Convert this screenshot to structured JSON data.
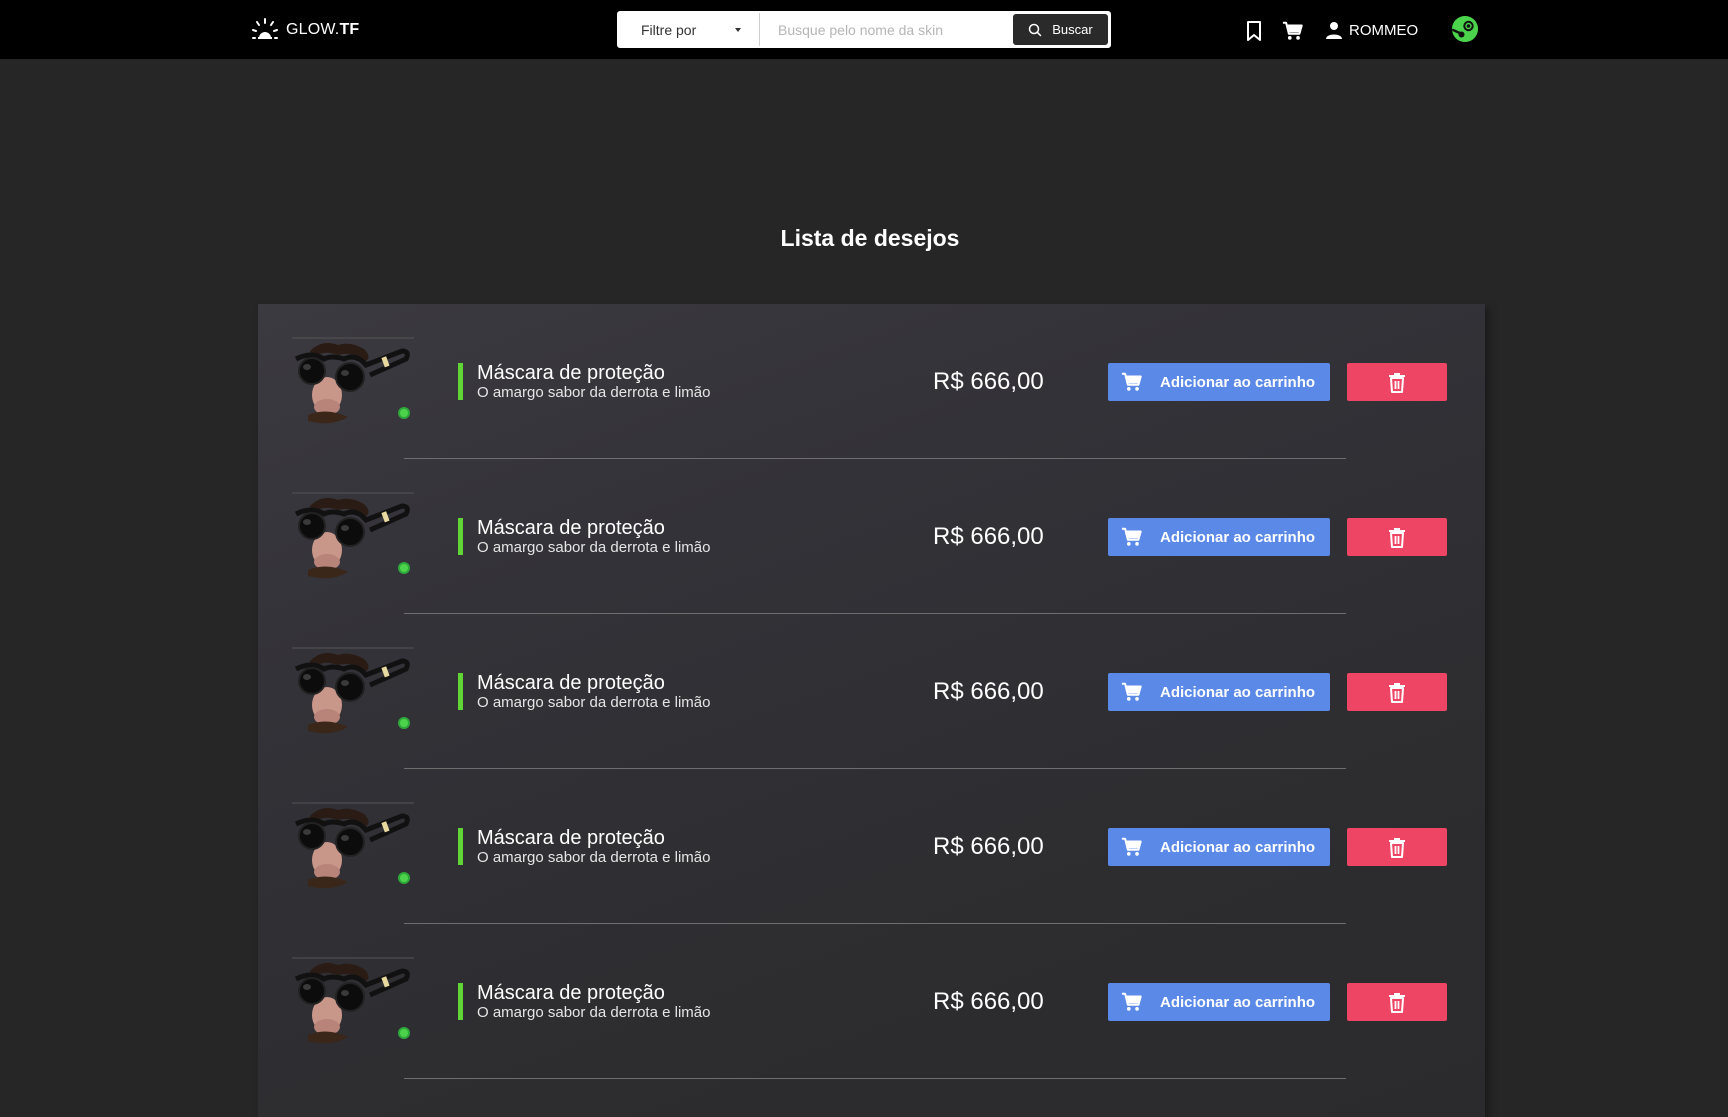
{
  "header": {
    "logo_text": "GLOW.",
    "logo_text_bold": "TF",
    "filter_label": "Filtre por",
    "search_placeholder": "Busque pelo nome da skin",
    "search_button": "Buscar",
    "username": "ROMMEO"
  },
  "page": {
    "title": "Lista de desejos"
  },
  "wishlist": {
    "items": [
      {
        "name": "Máscara de proteção",
        "subtitle": "O amargo sabor da derrota e limão",
        "price": "R$ 666,00",
        "add_label": "Adicionar ao carrinho"
      },
      {
        "name": "Máscara de proteção",
        "subtitle": "O amargo sabor da derrota e limão",
        "price": "R$ 666,00",
        "add_label": "Adicionar ao carrinho"
      },
      {
        "name": "Máscara de proteção",
        "subtitle": "O amargo sabor da derrota e limão",
        "price": "R$ 666,00",
        "add_label": "Adicionar ao carrinho"
      },
      {
        "name": "Máscara de proteção",
        "subtitle": "O amargo sabor da derrota e limão",
        "price": "R$ 666,00",
        "add_label": "Adicionar ao carrinho"
      },
      {
        "name": "Máscara de proteção",
        "subtitle": "O amargo sabor da derrota e limão",
        "price": "R$ 666,00",
        "add_label": "Adicionar ao carrinho"
      }
    ]
  },
  "colors": {
    "add_button": "#5b89e8",
    "delete_button": "#ef4564",
    "accent_bar": "#5fd636",
    "steam_badge": "#4bd34b"
  },
  "icons": [
    "sun-logo-icon",
    "chevron-down-icon",
    "search-icon",
    "bookmark-icon",
    "cart-icon",
    "user-icon",
    "steam-icon",
    "trash-icon"
  ]
}
